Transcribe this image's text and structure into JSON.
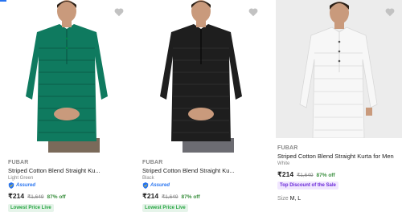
{
  "products": [
    {
      "brand": "FUBAR",
      "title": "Striped Cotton Blend Straight Ku...",
      "color": "Light Green",
      "assured_label": "Assured",
      "price": "₹214",
      "mrp": "₹1,649",
      "discount": "87% off",
      "badge": "Lowest Price Live",
      "shirt_color": "#0f7a5f",
      "skin": "#c99a7c"
    },
    {
      "brand": "FUBAR",
      "title": "Striped Cotton Blend Straight Ku...",
      "color": "Black",
      "assured_label": "Assured",
      "price": "₹214",
      "mrp": "₹1,649",
      "discount": "87% off",
      "badge": "Lowest Price Live",
      "shirt_color": "#1e1e1e",
      "skin": "#c99a7c"
    },
    {
      "brand": "FUBAR",
      "title": "Striped Cotton Blend Straight Kurta for Men",
      "color": "White",
      "price": "₹214",
      "mrp": "₹1,649",
      "discount": "87% off",
      "badge": "Top Discount of the Sale",
      "size_label": "Size",
      "sizes": "M, L",
      "shirt_color": "#f7f7f7",
      "skin": "#c99a7c"
    }
  ],
  "icons": {
    "wishlist": "heart-icon",
    "assured": "assured-shield-icon"
  },
  "colors": {
    "accent": "#2874f0",
    "discount_green": "#388e3c",
    "badge_green": "#26a541",
    "badge_purple": "#6b2ad8"
  }
}
